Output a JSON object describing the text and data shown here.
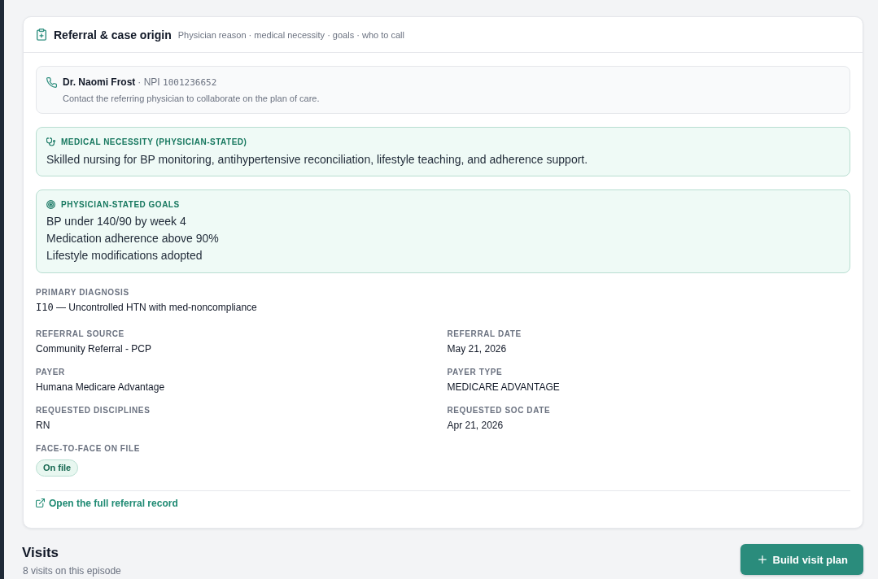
{
  "referral": {
    "title": "Referral & case origin",
    "subtitle": "Physician reason · medical necessity · goals · who to call",
    "contact": {
      "name": "Dr. Naomi Frost",
      "npi_prefix": "· NPI",
      "npi": "1001236652",
      "note": "Contact the referring physician to collaborate on the plan of care."
    },
    "medical_necessity": {
      "label": "MEDICAL NECESSITY (PHYSICIAN-STATED)",
      "text": "Skilled nursing for BP monitoring, antihypertensive reconciliation, lifestyle teaching, and adherence support."
    },
    "goals": {
      "label": "PHYSICIAN-STATED GOALS",
      "items": [
        "BP under 140/90 by week 4",
        "Medication adherence above 90%",
        "Lifestyle modifications adopted"
      ]
    },
    "primary_diagnosis": {
      "label": "PRIMARY DIAGNOSIS",
      "code": "I10",
      "description": "— Uncontrolled HTN with med-noncompliance"
    },
    "fields": [
      {
        "label": "REFERRAL SOURCE",
        "value": "Community Referral - PCP"
      },
      {
        "label": "REFERRAL DATE",
        "value": "May 21, 2026"
      },
      {
        "label": "PAYER",
        "value": "Humana Medicare Advantage"
      },
      {
        "label": "PAYER TYPE",
        "value": "MEDICARE ADVANTAGE"
      },
      {
        "label": "REQUESTED DISCIPLINES",
        "value": "RN"
      },
      {
        "label": "REQUESTED SOC DATE",
        "value": "Apr 21, 2026"
      }
    ],
    "face_to_face": {
      "label": "FACE-TO-FACE ON FILE",
      "badge": "On file"
    },
    "link": "Open the full referral record"
  },
  "visits": {
    "title": "Visits",
    "subtitle": "8 visits on this episode",
    "button": "Build visit plan"
  }
}
